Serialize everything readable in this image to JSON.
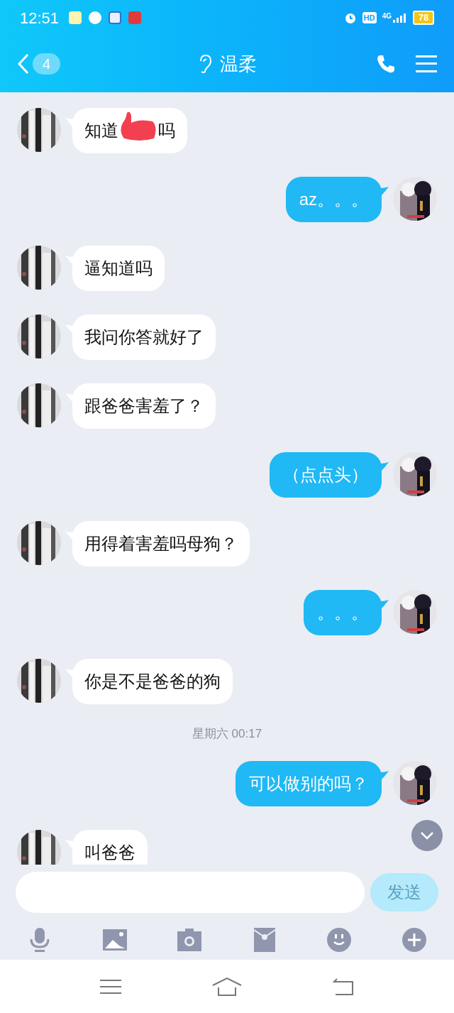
{
  "status_bar": {
    "time": "12:51",
    "network": "4G",
    "hd": "HD",
    "battery": "78"
  },
  "header": {
    "unread_count": "4",
    "title": "温柔"
  },
  "messages": [
    {
      "kind": "received",
      "text": "知道",
      "redacted": true,
      "text_after": "吗"
    },
    {
      "kind": "sent",
      "text": "az。。。"
    },
    {
      "kind": "received",
      "text": "逼知道吗"
    },
    {
      "kind": "received",
      "text": "我问你答就好了"
    },
    {
      "kind": "received",
      "text": "跟爸爸害羞了？"
    },
    {
      "kind": "sent",
      "text": "（点点头）"
    },
    {
      "kind": "received",
      "text": "用得着害羞吗母狗？"
    },
    {
      "kind": "sent",
      "text": "。。。"
    },
    {
      "kind": "received",
      "text": "你是不是爸爸的狗"
    },
    {
      "kind": "timestamp",
      "text": "星期六  00:17"
    },
    {
      "kind": "sent",
      "text": "可以做别的吗？"
    },
    {
      "kind": "received",
      "text": "叫爸爸"
    }
  ],
  "composer": {
    "send_label": "发送",
    "send_enabled": false
  }
}
